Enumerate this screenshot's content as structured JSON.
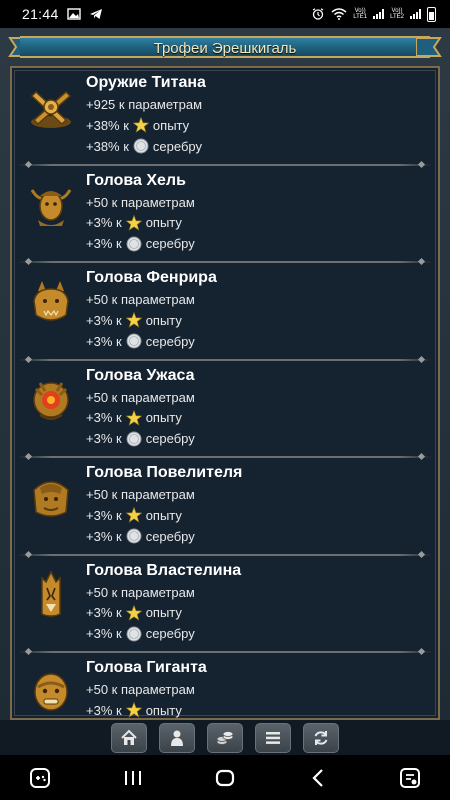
{
  "status": {
    "time": "21:44",
    "lte1": "LTE1",
    "lte2": "LTE2",
    "vo1": "Vo))",
    "vo2": "Vo))"
  },
  "title": "Трофеи Эрешкигаль",
  "items": [
    {
      "name": "Оружие Титана",
      "params": "+925 к параметрам",
      "exp_value": "+38% к",
      "exp_label": "опыту",
      "silver_value": "+38% к",
      "silver_label": "серебру",
      "icon": "titan-weapon-icon"
    },
    {
      "name": "Голова Хель",
      "params": "+50 к параметрам",
      "exp_value": "+3% к",
      "exp_label": "опыту",
      "silver_value": "+3% к",
      "silver_label": "серебру",
      "icon": "hel-head-icon"
    },
    {
      "name": "Голова Фенрира",
      "params": "+50 к параметрам",
      "exp_value": "+3% к",
      "exp_label": "опыту",
      "silver_value": "+3% к",
      "silver_label": "серебру",
      "icon": "fenrir-head-icon"
    },
    {
      "name": "Голова Ужаса",
      "params": "+50 к параметрам",
      "exp_value": "+3% к",
      "exp_label": "опыту",
      "silver_value": "+3% к",
      "silver_label": "серебру",
      "icon": "horror-head-icon"
    },
    {
      "name": "Голова Повелителя",
      "params": "+50 к параметрам",
      "exp_value": "+3% к",
      "exp_label": "опыту",
      "silver_value": "+3% к",
      "silver_label": "серебру",
      "icon": "lord-head-icon"
    },
    {
      "name": "Голова Властелина",
      "params": "+50 к параметрам",
      "exp_value": "+3% к",
      "exp_label": "опыту",
      "silver_value": "+3% к",
      "silver_label": "серебру",
      "icon": "overlord-head-icon"
    },
    {
      "name": "Голова Гиганта",
      "params": "+50 к параметрам",
      "exp_value": "+3% к",
      "exp_label": "опыту",
      "silver_value": "",
      "silver_label": "",
      "icon": "giant-head-icon"
    }
  ],
  "toolbar": [
    "home-icon",
    "character-icon",
    "coins-icon",
    "menu-icon",
    "refresh-icon"
  ],
  "navbar": [
    "game-launcher-icon",
    "recent-apps-icon",
    "home-button-icon",
    "back-icon",
    "screenshot-icon"
  ],
  "colors": {
    "accent_gold": "#c8a85e",
    "banner_blue": "#1f5f7d",
    "panel_bg": "#152230"
  }
}
